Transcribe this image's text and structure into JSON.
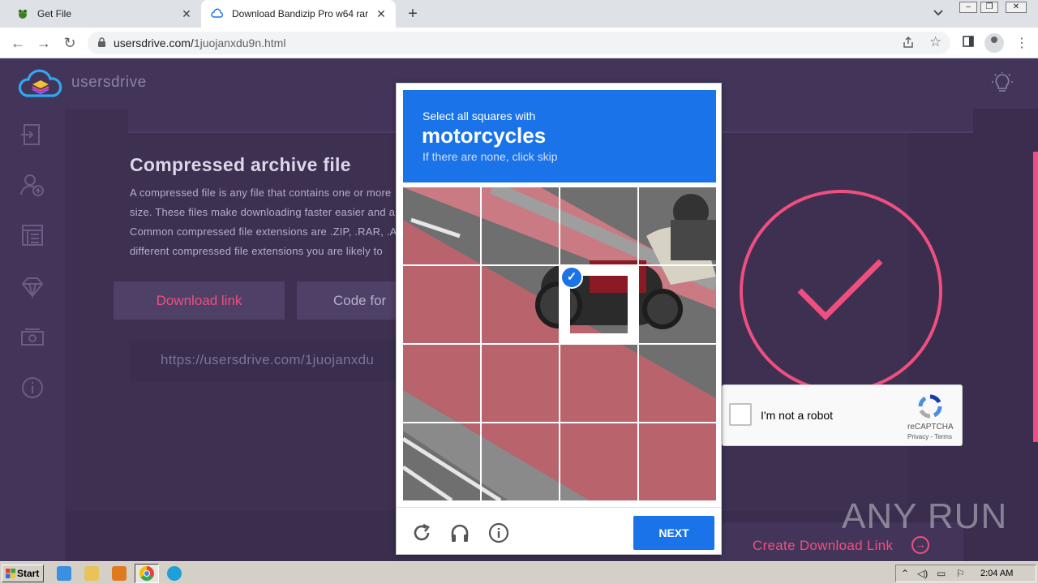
{
  "browser": {
    "tabs": [
      {
        "title": "Get File",
        "icon": "frog-icon"
      },
      {
        "title": "Download Bandizip Pro w64 rar",
        "icon": "cloud-icon"
      }
    ],
    "url_prefix": "usersdrive.com/",
    "url_path": "1juojanxdu9n.html"
  },
  "site": {
    "brand": "usersdrive",
    "heading": "Compressed archive file",
    "paragraph_lines": [
      "A compressed file is any file that contains one or more",
      "size. These files make downloading faster easier and al",
      "Common compressed file extensions are .ZIP, .RAR, .AR",
      "different compressed file extensions you are likely to"
    ],
    "download_link_label": "Download link",
    "code_for_label": "Code for",
    "link_text": "https://usersdrive.com/1juojanxdu",
    "create_download_label": "Create Download Link",
    "accent_color": "#ef4f7f"
  },
  "recaptcha_anchor": {
    "label": "I'm not a robot",
    "brand": "reCAPTCHA",
    "links": "Privacy - Terms"
  },
  "recaptcha_challenge": {
    "instruction": "Select all squares with",
    "object": "motorcycles",
    "hint": "If there are none, click skip",
    "next_label": "NEXT",
    "grid_size": 4,
    "selected_tiles": [
      "row 2, column 3"
    ],
    "accent_color": "#1a73e8"
  },
  "watermark": "ANY RUN",
  "taskbar": {
    "start_label": "Start",
    "clock": "2:04 AM"
  }
}
